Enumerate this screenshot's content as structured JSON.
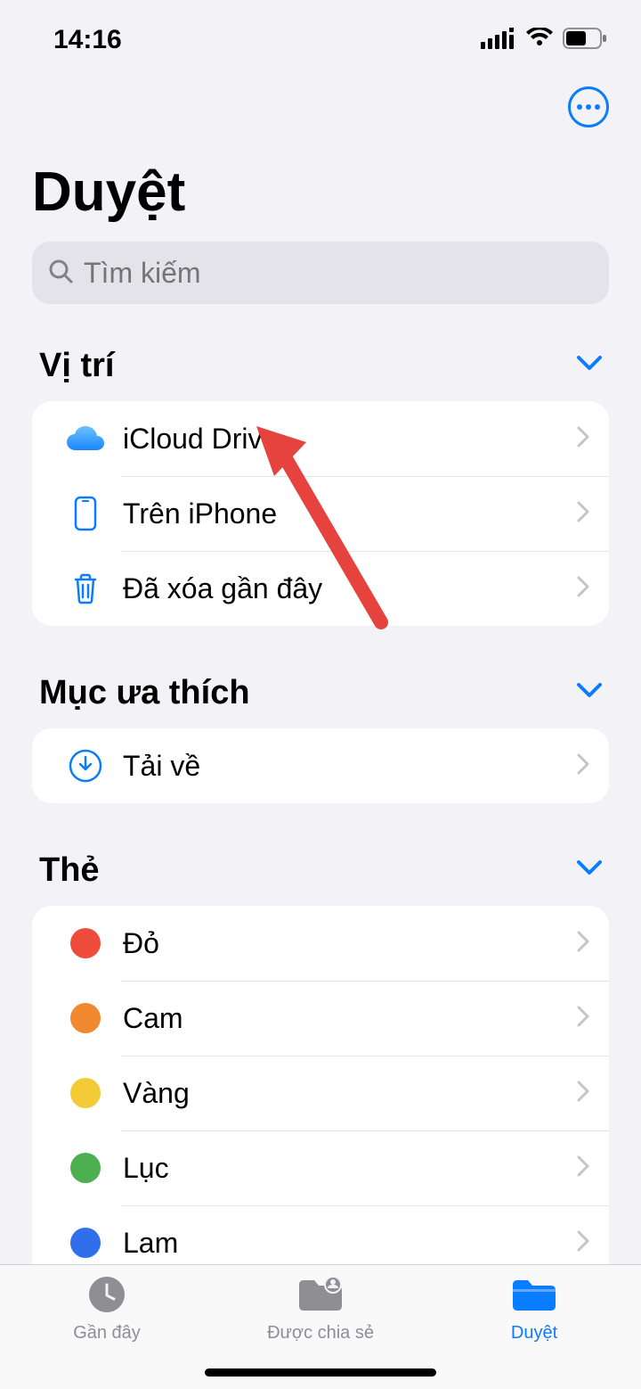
{
  "status": {
    "time": "14:16"
  },
  "title": "Duyệt",
  "search": {
    "placeholder": "Tìm kiếm"
  },
  "sections": {
    "locations": {
      "title": "Vị trí",
      "items": [
        {
          "label": "iCloud Drive"
        },
        {
          "label": "Trên iPhone"
        },
        {
          "label": "Đã xóa gần đây"
        }
      ]
    },
    "favorites": {
      "title": "Mục ưa thích",
      "items": [
        {
          "label": "Tải về"
        }
      ]
    },
    "tags": {
      "title": "Thẻ",
      "items": [
        {
          "label": "Đỏ",
          "color": "#ef4b3a"
        },
        {
          "label": "Cam",
          "color": "#f0892f"
        },
        {
          "label": "Vàng",
          "color": "#f3cb36"
        },
        {
          "label": "Lục",
          "color": "#4caf50"
        },
        {
          "label": "Lam",
          "color": "#2f6fec"
        }
      ]
    }
  },
  "tabs": [
    {
      "label": "Gần đây"
    },
    {
      "label": "Được chia sẻ"
    },
    {
      "label": "Duyệt"
    }
  ],
  "colors": {
    "accent": "#0a7cff",
    "inactive": "#8e8e93"
  }
}
